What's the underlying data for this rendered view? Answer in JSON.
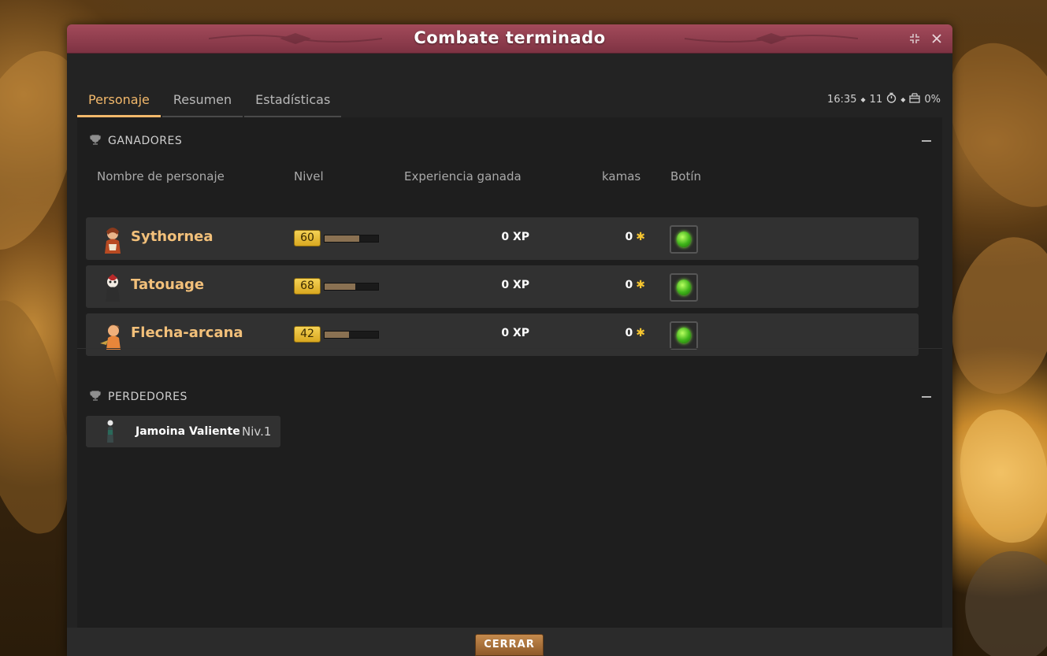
{
  "window": {
    "title": "Combate terminado"
  },
  "tabs": [
    {
      "label": "Personaje",
      "active": true
    },
    {
      "label": "Resumen",
      "active": false
    },
    {
      "label": "Estadísticas",
      "active": false
    }
  ],
  "meta": {
    "time": "16:35",
    "turns": "11",
    "drop_bonus": "0%"
  },
  "winners": {
    "heading": "GANADORES",
    "columns": {
      "name": "Nombre de personaje",
      "level": "Nivel",
      "xp": "Experiencia ganada",
      "kamas": "kamas",
      "loot": "Botín"
    },
    "rows": [
      {
        "name": "Sythornea",
        "level": "60",
        "level_progress": 0.65,
        "xp": "0 XP",
        "kamas": "0"
      },
      {
        "name": "Tatouage",
        "level": "68",
        "level_progress": 0.57,
        "xp": "0 XP",
        "kamas": "0"
      },
      {
        "name": "Flecha-arcana",
        "level": "42",
        "level_progress": 0.45,
        "xp": "0 XP",
        "kamas": "0"
      }
    ]
  },
  "losers": {
    "heading": "PERDEDORES",
    "rows": [
      {
        "name": "Jamoina Valiente",
        "level": "Niv.1"
      }
    ]
  },
  "footer": {
    "close_label": "CERRAR"
  },
  "colors": {
    "title_bar": "#8f3e4f",
    "accent": "#f2b86b",
    "player_name": "#f2c07a",
    "kamas_icon": "#f4c430",
    "loot_gem": "#3fb31a"
  }
}
